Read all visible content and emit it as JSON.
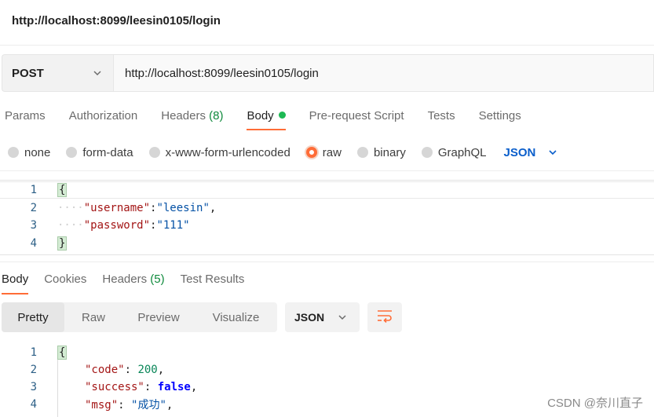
{
  "title": "http://localhost:8099/leesin0105/login",
  "request": {
    "method": "POST",
    "url": "http://localhost:8099/leesin0105/login"
  },
  "request_tabs": [
    {
      "label": "Params"
    },
    {
      "label": "Authorization"
    },
    {
      "label": "Headers",
      "count": "(8)"
    },
    {
      "label": "Body"
    },
    {
      "label": "Pre-request Script"
    },
    {
      "label": "Tests"
    },
    {
      "label": "Settings"
    }
  ],
  "body_types": {
    "none": "none",
    "form_data": "form-data",
    "urlencoded": "x-www-form-urlencoded",
    "raw": "raw",
    "binary": "binary",
    "graphql": "GraphQL",
    "format": "JSON"
  },
  "request_body": {
    "line_numbers": [
      "1",
      "2",
      "3",
      "4"
    ],
    "open": "{",
    "indent": "····",
    "username_key": "\"username\"",
    "username_value": "\"leesin\"",
    "password_key": "\"password\"",
    "password_value": "\"111\"",
    "close": "}"
  },
  "response_tabs": [
    {
      "label": "Body"
    },
    {
      "label": "Cookies"
    },
    {
      "label": "Headers",
      "count": "(5)"
    },
    {
      "label": "Test Results"
    }
  ],
  "view_modes": [
    "Pretty",
    "Raw",
    "Preview",
    "Visualize"
  ],
  "response_format": "JSON",
  "response_body": {
    "line_numbers": [
      "1",
      "2",
      "3",
      "4"
    ],
    "open": "{",
    "code_key": "\"code\"",
    "code_value": "200",
    "success_key": "\"success\"",
    "success_value": "false",
    "msg_key": "\"msg\"",
    "msg_value": "\"成功\""
  },
  "watermark": "CSDN @奈川直子",
  "colors": {
    "accent": "#ff6c37",
    "active_dot": "#1db954",
    "count": "#0f8a3c",
    "link": "#0a5ecb"
  }
}
